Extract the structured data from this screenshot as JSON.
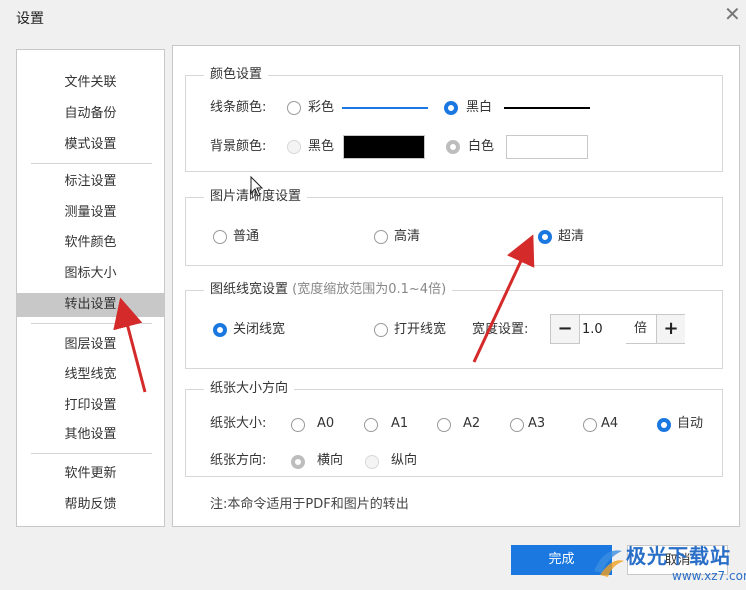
{
  "window": {
    "title": "设置"
  },
  "sidebar": {
    "items": [
      {
        "label": "文件关联"
      },
      {
        "label": "自动备份"
      },
      {
        "label": "模式设置"
      },
      {
        "label": "标注设置"
      },
      {
        "label": "测量设置"
      },
      {
        "label": "软件颜色"
      },
      {
        "label": "图标大小"
      },
      {
        "label": "转出设置",
        "active": true
      },
      {
        "label": "图层设置"
      },
      {
        "label": "线型线宽"
      },
      {
        "label": "打印设置"
      },
      {
        "label": "其他设置"
      },
      {
        "label": "软件更新"
      },
      {
        "label": "帮助反馈"
      }
    ]
  },
  "color_settings": {
    "title": "颜色设置",
    "line_color": {
      "label": "线条颜色:",
      "opt_color": "彩色",
      "opt_bw": "黑白",
      "selected": "黑白",
      "color_line": "#1a78e0",
      "bw_line": "#000000"
    },
    "bg_color": {
      "label": "背景颜色:",
      "opt_black": "黑色",
      "opt_white": "白色",
      "selected": "白色",
      "disabled": true,
      "black_swatch": "#000000",
      "white_swatch": "#ffffff"
    }
  },
  "clarity": {
    "title": "图片清晰度设置",
    "options": [
      "普通",
      "高清",
      "超清"
    ],
    "selected": "超清"
  },
  "line_width": {
    "title": "图纸线宽设置",
    "hint": "(宽度缩放范围为0.1~4倍)",
    "options": [
      "关闭线宽",
      "打开线宽"
    ],
    "selected": "关闭线宽",
    "width_label": "宽度设置:",
    "value": "1.0",
    "unit": "倍",
    "minus": "−",
    "plus": "+"
  },
  "paper": {
    "title": "纸张大小方向",
    "size_label": "纸张大小:",
    "sizes": [
      "A0",
      "A1",
      "A2",
      "A3",
      "A4",
      "自动"
    ],
    "size_selected": "自动",
    "orient_label": "纸张方向:",
    "orientations": [
      "横向",
      "纵向"
    ],
    "orient_selected": "横向",
    "orient_disabled": true
  },
  "note": "注:本命令适用于PDF和图片的转出",
  "buttons": {
    "ok": "完成",
    "cancel": "取消"
  },
  "watermark": {
    "line1": "极光下载站",
    "line2": "www.xz7.com"
  },
  "colors": {
    "accent": "#1a78e0",
    "annotation_arrow": "#d42a2a",
    "sidebar_active": "#c8c8c8"
  },
  "icons": {
    "close": "close-icon",
    "watermark_logo": "aurora-logo-icon"
  }
}
